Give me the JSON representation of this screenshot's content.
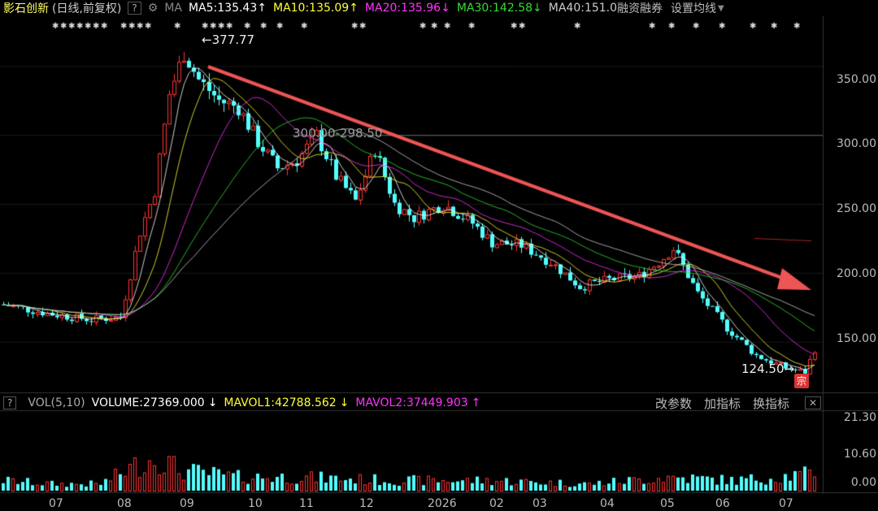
{
  "header": {
    "stock_name": "影石创新",
    "period": "(日线,前复权)",
    "help_icon_text": "?",
    "ma_label": "MA",
    "ma5": "MA5:135.43",
    "ma10": "MA10:135.09",
    "ma20": "MA20:135.96",
    "ma30": "MA30:142.58",
    "ma40": "MA40:151.0",
    "margin_trading": "融资融券",
    "settings": "设置均线",
    "up_arrow": "↑",
    "down_arrow": "↓",
    "colors": {
      "ma5": "#ffffff",
      "ma10": "#ffff33",
      "ma20": "#ff33ff",
      "ma30": "#33dd33",
      "ma40": "#cccccc"
    }
  },
  "volume_header": {
    "help_icon_text": "?",
    "vol_label": "VOL(5,10)",
    "volume": "VOLUME:27369.000",
    "mavol1": "MAVOL1:42788.562",
    "mavol2": "MAVOL2:37449.903",
    "change_params": "改参数",
    "add_indicator": "加指标",
    "swap_indicator": "换指标",
    "close_icon_text": "✕"
  },
  "chart_data": {
    "type": "candlestick",
    "title": "影石创新 (日线,前复权)",
    "price_axis": {
      "ticks": [
        "350.00",
        "300.00",
        "250.00",
        "200.00",
        "150.00"
      ],
      "ylim": [
        115,
        385
      ]
    },
    "volume_axis": {
      "ticks": [
        "21.30",
        "10.60",
        "0.00"
      ],
      "ylim": [
        0,
        24
      ]
    },
    "x_ticks": [
      "07",
      "08",
      "09",
      "10",
      "11",
      "12",
      "2026",
      "02",
      "03",
      "04",
      "05",
      "06",
      "07"
    ],
    "annotations": {
      "high": "377.77",
      "low": "124.50",
      "hline": "300.00-298.50",
      "badge": "宗"
    },
    "close_path": [
      {
        "t": 0,
        "v": 177
      },
      {
        "t": 10,
        "v": 170
      },
      {
        "t": 18,
        "v": 166
      },
      {
        "t": 24,
        "v": 168
      },
      {
        "t": 28,
        "v": 230
      },
      {
        "t": 31,
        "v": 260
      },
      {
        "t": 34,
        "v": 330
      },
      {
        "t": 37,
        "v": 360
      },
      {
        "t": 40,
        "v": 340
      },
      {
        "t": 44,
        "v": 325
      },
      {
        "t": 48,
        "v": 320
      },
      {
        "t": 52,
        "v": 295
      },
      {
        "t": 56,
        "v": 276
      },
      {
        "t": 60,
        "v": 282
      },
      {
        "t": 64,
        "v": 300
      },
      {
        "t": 68,
        "v": 270
      },
      {
        "t": 72,
        "v": 252
      },
      {
        "t": 76,
        "v": 290
      },
      {
        "t": 80,
        "v": 250
      },
      {
        "t": 84,
        "v": 240
      },
      {
        "t": 90,
        "v": 250
      },
      {
        "t": 96,
        "v": 236
      },
      {
        "t": 100,
        "v": 222
      },
      {
        "t": 106,
        "v": 220
      },
      {
        "t": 112,
        "v": 208
      },
      {
        "t": 118,
        "v": 190
      },
      {
        "t": 124,
        "v": 195
      },
      {
        "t": 130,
        "v": 198
      },
      {
        "t": 134,
        "v": 208
      },
      {
        "t": 137,
        "v": 218
      },
      {
        "t": 142,
        "v": 185
      },
      {
        "t": 148,
        "v": 160
      },
      {
        "t": 154,
        "v": 140
      },
      {
        "t": 160,
        "v": 131
      },
      {
        "t": 164,
        "v": 128
      },
      {
        "t": 166,
        "v": 145
      }
    ],
    "volume_path": [
      {
        "t": 0,
        "v": 3
      },
      {
        "t": 10,
        "v": 2
      },
      {
        "t": 20,
        "v": 2
      },
      {
        "t": 28,
        "v": 8
      },
      {
        "t": 32,
        "v": 10
      },
      {
        "t": 36,
        "v": 6
      },
      {
        "t": 48,
        "v": 4
      },
      {
        "t": 60,
        "v": 4
      },
      {
        "t": 80,
        "v": 3
      },
      {
        "t": 100,
        "v": 3
      },
      {
        "t": 120,
        "v": 2
      },
      {
        "t": 136,
        "v": 4
      },
      {
        "t": 150,
        "v": 3
      },
      {
        "t": 166,
        "v": 5
      }
    ]
  }
}
